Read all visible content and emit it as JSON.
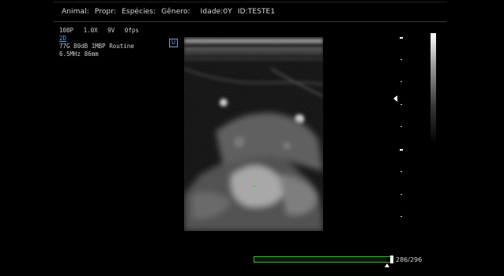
{
  "header": {
    "animal": "Animal:",
    "owner": "Propr:",
    "species": "Espécies:",
    "gender": "Gênero:",
    "age": "Idade:0Y",
    "id": "ID:TESTE1"
  },
  "params": {
    "line1": [
      "108P",
      "1.0X",
      "9V",
      "0fps"
    ],
    "mode": "2D",
    "line3": "77G 80dB 1MBP Routine",
    "line4": "6.5MHz 86mm"
  },
  "orientation_marker": "U",
  "cine": {
    "current": 286,
    "total": 296,
    "counter": "286/296",
    "accent": "#46b046"
  },
  "colors": {
    "background": "#000000",
    "mode_label": "#4aa3ff",
    "progress_border": "#46b046"
  }
}
